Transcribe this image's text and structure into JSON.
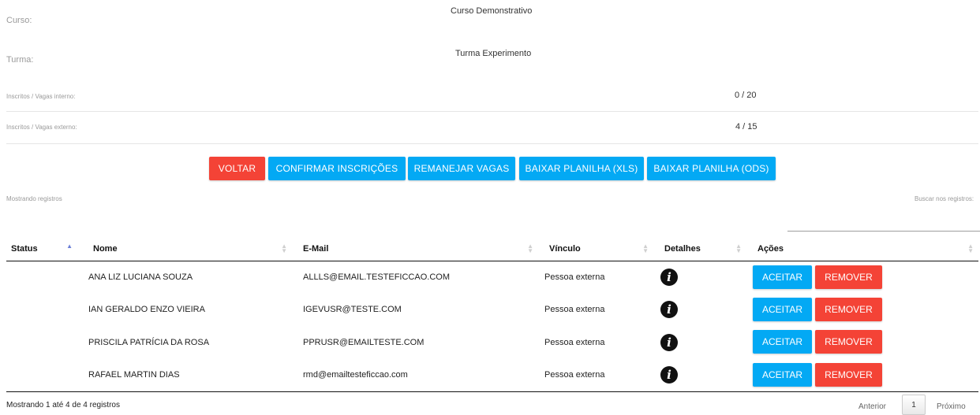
{
  "info": {
    "curso_label": "Curso:",
    "curso_value": "Curso Demonstrativo",
    "turma_label": "Turma:",
    "turma_value": "Turma Experimento",
    "interno_label": "Inscritos / Vagas interno:",
    "interno_value": "0 / 20",
    "externo_label": "Inscritos / Vagas externo:",
    "externo_value": "4 / 15"
  },
  "toolbar": {
    "voltar": "VOLTAR",
    "confirmar": "CONFIRMAR INSCRIÇÕES",
    "remanejar": "REMANEJAR VAGAS",
    "xls": "BAIXAR PLANILHA (XLS)",
    "ods": "BAIXAR PLANILHA (ODS)"
  },
  "table_meta": {
    "showing": "Mostrando registros",
    "search_label": "Buscar nos registros:"
  },
  "table": {
    "headers": [
      "Status",
      "Nome",
      "E-Mail",
      "Vínculo",
      "Detalhes",
      "Ações"
    ],
    "rows": [
      {
        "status": "",
        "nome": "ANA LIZ LUCIANA SOUZA",
        "email": "ALLLS@EMAIL.TESTEFICCAO.COM",
        "vinculo": "Pessoa externa"
      },
      {
        "status": "",
        "nome": "IAN GERALDO ENZO VIEIRA",
        "email": "IGEVUSR@TESTE.COM",
        "vinculo": "Pessoa externa"
      },
      {
        "status": "",
        "nome": "PRISCILA PATRÍCIA DA ROSA",
        "email": "PPRUSR@EMAILTESTE.COM",
        "vinculo": "Pessoa externa"
      },
      {
        "status": "",
        "nome": "RAFAEL MARTIN DIAS",
        "email": "rmd@emailtesteficcao.com",
        "vinculo": "Pessoa externa"
      }
    ],
    "accept_label": "ACEITAR",
    "remove_label": "REMOVER",
    "details_icon": "info-circle-icon"
  },
  "footer": {
    "summary": "Mostrando 1 até 4 de 4 registros",
    "prev": "Anterior",
    "page": "1",
    "next": "Próximo"
  },
  "colors": {
    "danger": "#f44336",
    "primary": "#03a9f4"
  }
}
